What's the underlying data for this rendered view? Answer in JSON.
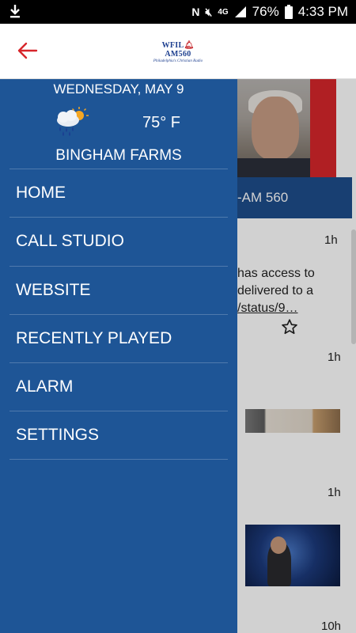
{
  "status_bar": {
    "battery": "76%",
    "time": "4:33 PM",
    "icons": [
      "download-icon",
      "nfc-icon",
      "mute-icon",
      "lte-icon",
      "signal-icon",
      "battery-icon"
    ]
  },
  "header": {
    "back_icon": "arrow-left-icon",
    "logo_call": "WFIL",
    "logo_am": "AM560",
    "logo_tagline": "Philadelphia's Christian Radio",
    "accent": "#d7262b"
  },
  "drawer": {
    "date": "WEDNESDAY, MAY 9",
    "weather_icon": "rain-sun-cloud-icon",
    "temperature": "75° F",
    "location": "BINGHAM FARMS",
    "background": "#1e5596",
    "menu": [
      {
        "label": "HOME"
      },
      {
        "label": "CALL STUDIO"
      },
      {
        "label": "WEBSITE"
      },
      {
        "label": "RECENTLY PLAYED"
      },
      {
        "label": "ALARM"
      },
      {
        "label": "SETTINGS"
      }
    ]
  },
  "feed": {
    "station_label": "-AM 560",
    "items": [
      {
        "time": "1h",
        "line1": "has access to",
        "line2": " delivered to a",
        "line3": "/status/9…"
      },
      {
        "time": "1h"
      },
      {
        "time": "1h"
      },
      {
        "time": "10h"
      }
    ]
  }
}
